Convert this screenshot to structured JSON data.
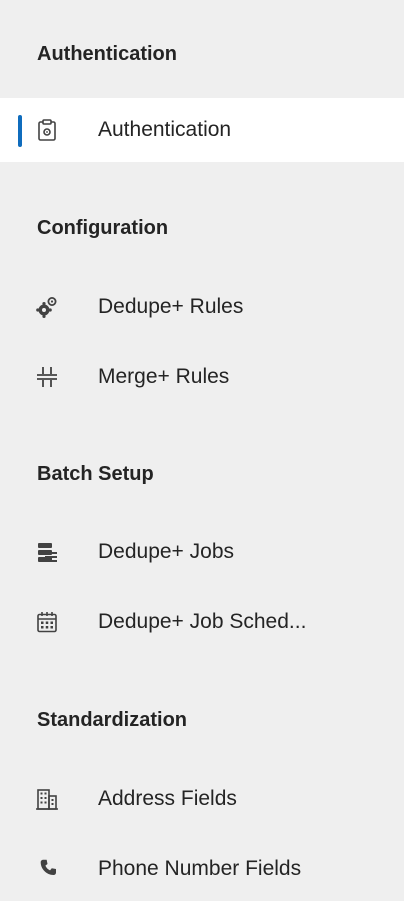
{
  "sections": [
    {
      "header": "Authentication",
      "items": [
        {
          "label": "Authentication",
          "icon": "clipboard-settings-icon",
          "selected": true
        }
      ]
    },
    {
      "header": "Configuration",
      "items": [
        {
          "label": "Dedupe+ Rules",
          "icon": "gears-icon"
        },
        {
          "label": "Merge+ Rules",
          "icon": "merge-icon"
        }
      ]
    },
    {
      "header": "Batch Setup",
      "items": [
        {
          "label": "Dedupe+ Jobs",
          "icon": "database-list-icon"
        },
        {
          "label": "Dedupe+ Job Sched...",
          "icon": "calendar-icon"
        }
      ]
    },
    {
      "header": "Standardization",
      "items": [
        {
          "label": "Address Fields",
          "icon": "building-icon"
        },
        {
          "label": "Phone Number Fields",
          "icon": "phone-icon"
        }
      ]
    }
  ],
  "colors": {
    "selected_indicator": "#0f6cbd",
    "background": "#efefef",
    "selected_background": "#ffffff"
  }
}
